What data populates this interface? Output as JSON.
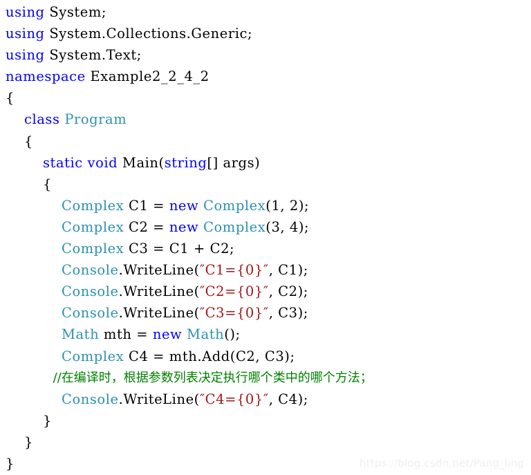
{
  "editor": {
    "language": "C#",
    "background_color": "#ffffff",
    "colors": {
      "keyword": "#0000FF",
      "type": "#2B91AF",
      "string": "#A31515",
      "comment": "#008000",
      "plain": "#000000",
      "watermark": "#EFEFEF"
    }
  },
  "watermark": {
    "text": "https://blog.csdn.net/Pang_ling"
  },
  "code": {
    "lines": [
      {
        "indent": "",
        "segments": [
          {
            "text": "using",
            "kind": "keyword"
          },
          {
            "text": " System;",
            "kind": "plain"
          }
        ]
      },
      {
        "indent": "",
        "segments": [
          {
            "text": "using",
            "kind": "keyword"
          },
          {
            "text": " System.Collections.Generic;",
            "kind": "plain"
          }
        ]
      },
      {
        "indent": "",
        "segments": [
          {
            "text": "using",
            "kind": "keyword"
          },
          {
            "text": " System.Text;",
            "kind": "plain"
          }
        ]
      },
      {
        "indent": "",
        "segments": [
          {
            "text": "namespace",
            "kind": "keyword"
          },
          {
            "text": " Example2_2_4_2",
            "kind": "plain"
          }
        ]
      },
      {
        "indent": "",
        "segments": [
          {
            "text": "{",
            "kind": "plain"
          }
        ]
      },
      {
        "indent": "    ",
        "segments": [
          {
            "text": "class",
            "kind": "keyword"
          },
          {
            "text": " ",
            "kind": "plain"
          },
          {
            "text": "Program",
            "kind": "type"
          }
        ]
      },
      {
        "indent": "    ",
        "segments": [
          {
            "text": "{",
            "kind": "plain"
          }
        ]
      },
      {
        "indent": "        ",
        "segments": [
          {
            "text": "static void",
            "kind": "keyword"
          },
          {
            "text": " Main(",
            "kind": "plain"
          },
          {
            "text": "string",
            "kind": "keyword"
          },
          {
            "text": "[] args)",
            "kind": "plain"
          }
        ]
      },
      {
        "indent": "        ",
        "segments": [
          {
            "text": "{",
            "kind": "plain"
          }
        ]
      },
      {
        "indent": "            ",
        "segments": [
          {
            "text": "Complex",
            "kind": "type"
          },
          {
            "text": " C1 = ",
            "kind": "plain"
          },
          {
            "text": "new",
            "kind": "keyword"
          },
          {
            "text": " ",
            "kind": "plain"
          },
          {
            "text": "Complex",
            "kind": "type"
          },
          {
            "text": "(1, 2);",
            "kind": "plain"
          }
        ]
      },
      {
        "indent": "            ",
        "segments": [
          {
            "text": "Complex",
            "kind": "type"
          },
          {
            "text": " C2 = ",
            "kind": "plain"
          },
          {
            "text": "new",
            "kind": "keyword"
          },
          {
            "text": " ",
            "kind": "plain"
          },
          {
            "text": "Complex",
            "kind": "type"
          },
          {
            "text": "(3, 4);",
            "kind": "plain"
          }
        ]
      },
      {
        "indent": "            ",
        "segments": [
          {
            "text": "Complex",
            "kind": "type"
          },
          {
            "text": " C3 = C1 + C2;",
            "kind": "plain"
          }
        ]
      },
      {
        "indent": "            ",
        "segments": [
          {
            "text": "Console",
            "kind": "type"
          },
          {
            "text": ".WriteLine(",
            "kind": "plain"
          },
          {
            "text": "″C1={0}″",
            "kind": "string"
          },
          {
            "text": ", C1);",
            "kind": "plain"
          }
        ]
      },
      {
        "indent": "            ",
        "segments": [
          {
            "text": "Console",
            "kind": "type"
          },
          {
            "text": ".WriteLine(",
            "kind": "plain"
          },
          {
            "text": "″C2={0}″",
            "kind": "string"
          },
          {
            "text": ", C2);",
            "kind": "plain"
          }
        ]
      },
      {
        "indent": "            ",
        "segments": [
          {
            "text": "Console",
            "kind": "type"
          },
          {
            "text": ".WriteLine(",
            "kind": "plain"
          },
          {
            "text": "″C3={0}″",
            "kind": "string"
          },
          {
            "text": ", C3);",
            "kind": "plain"
          }
        ]
      },
      {
        "indent": "            ",
        "segments": [
          {
            "text": "Math",
            "kind": "type"
          },
          {
            "text": " mth = ",
            "kind": "plain"
          },
          {
            "text": "new",
            "kind": "keyword"
          },
          {
            "text": " ",
            "kind": "plain"
          },
          {
            "text": "Math",
            "kind": "type"
          },
          {
            "text": "();",
            "kind": "plain"
          }
        ]
      },
      {
        "indent": "            ",
        "segments": [
          {
            "text": "Complex",
            "kind": "type"
          },
          {
            "text": " C4 = mth.Add(C2, C3);",
            "kind": "plain"
          }
        ]
      },
      {
        "indent": "            ",
        "cjk": true,
        "segments": [
          {
            "text": "//在编译时，根据参数列表决定执行哪个类中的哪个方法；",
            "kind": "comment"
          }
        ]
      },
      {
        "indent": "            ",
        "segments": [
          {
            "text": "Console",
            "kind": "type"
          },
          {
            "text": ".WriteLine(",
            "kind": "plain"
          },
          {
            "text": "″C4={0}″",
            "kind": "string"
          },
          {
            "text": ", C4);",
            "kind": "plain"
          }
        ]
      },
      {
        "indent": "        ",
        "segments": [
          {
            "text": "}",
            "kind": "plain"
          }
        ]
      },
      {
        "indent": "    ",
        "segments": [
          {
            "text": "}",
            "kind": "plain"
          }
        ]
      },
      {
        "indent": "",
        "segments": [
          {
            "text": "}",
            "kind": "plain"
          }
        ]
      }
    ]
  }
}
